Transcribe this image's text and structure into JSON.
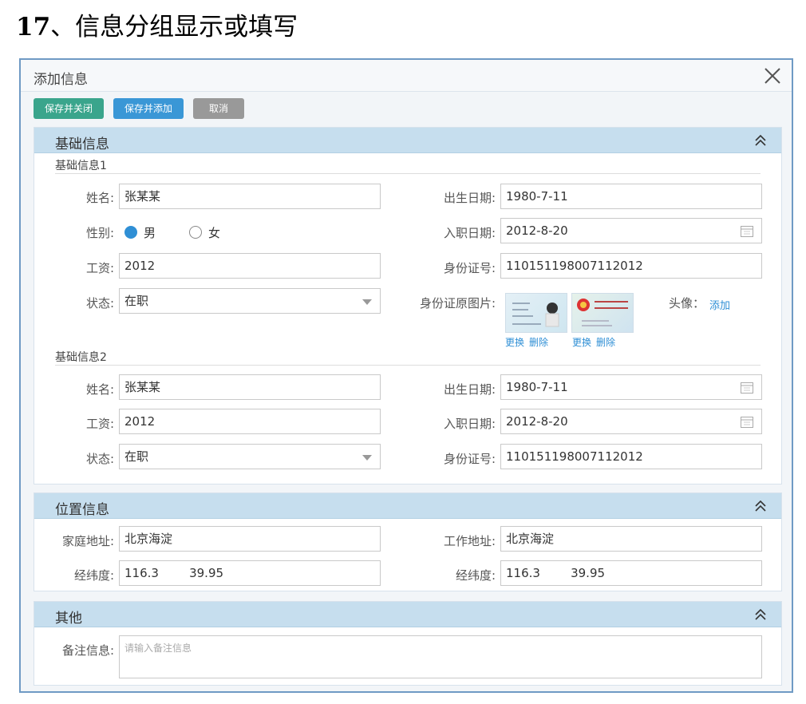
{
  "heading": {
    "number": "17",
    "text": "、信息分组显示或填写"
  },
  "dialog": {
    "title": "添加信息"
  },
  "toolbar": {
    "save_close": "保存并关闭",
    "save_add": "保存并添加",
    "cancel": "取消"
  },
  "basic": {
    "title": "基础信息",
    "group1": {
      "title": "基础信息1",
      "name_label": "姓名:",
      "name_value": "张某某",
      "birth_label": "出生日期:",
      "birth_value": "1980-7-11",
      "gender_label": "性别:",
      "gender_male": "男",
      "gender_female": "女",
      "gender_selected": "男",
      "hire_label": "入职日期:",
      "hire_value": "2012-8-20",
      "salary_label": "工资:",
      "salary_value": "2012",
      "idno_label": "身份证号:",
      "idno_value": "110151198007112012",
      "status_label": "状态:",
      "status_value": "在职",
      "idimg_label": "身份证原图片:",
      "img1_change": "更换",
      "img1_delete": "删除",
      "img2_change": "更换",
      "img2_delete": "删除",
      "avatar_label": "头像：",
      "avatar_add": "添加"
    },
    "group2": {
      "title": "基础信息2",
      "name_label": "姓名:",
      "name_value": "张某某",
      "birth_label": "出生日期:",
      "birth_value": "1980-7-11",
      "salary_label": "工资:",
      "salary_value": "2012",
      "hire_label": "入职日期:",
      "hire_value": "2012-8-20",
      "status_label": "状态:",
      "status_value": "在职",
      "idno_label": "身份证号:",
      "idno_value": "110151198007112012"
    }
  },
  "location": {
    "title": "位置信息",
    "home_label": "家庭地址:",
    "home_value": "北京海淀",
    "work_label": "工作地址:",
    "work_value": "北京海淀",
    "coord1_label": "经纬度:",
    "coord1_value": "116.3        39.95",
    "coord2_label": "经纬度:",
    "coord2_value": "116.3        39.95"
  },
  "other": {
    "title": "其他",
    "remark_label": "备注信息:",
    "remark_placeholder": "请输入备注信息"
  },
  "colors": {
    "accent": "#2f8fd5",
    "green": "#3aa58c",
    "panel_header": "#c6deee",
    "border": "#6f9ac4"
  },
  "icons": [
    "close-icon",
    "collapse-up-icon",
    "calendar-icon",
    "dropdown-arrow-icon"
  ]
}
